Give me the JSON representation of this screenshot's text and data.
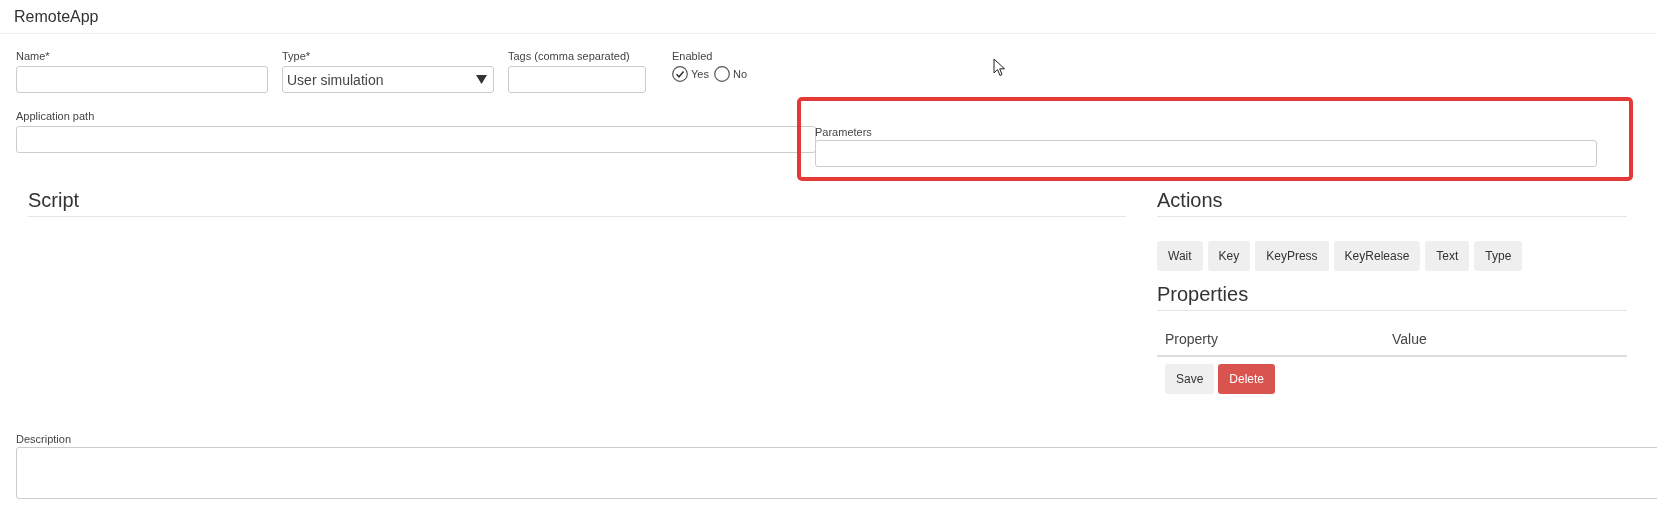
{
  "title": "RemoteApp",
  "fields": [
    {
      "label": "Name*",
      "kind": "text"
    },
    {
      "label": "Type*",
      "kind": "select",
      "value": "User simulation"
    },
    {
      "label": "Tags (comma separated)",
      "kind": "text"
    }
  ],
  "enabled": {
    "label": "Enabled",
    "options": [
      {
        "label": "Yes",
        "selected": true
      },
      {
        "label": "No",
        "selected": false
      }
    ]
  },
  "application_path": {
    "label": "Application path"
  },
  "parameters": {
    "label": "Parameters",
    "highlighted": true
  },
  "script": {
    "heading": "Script"
  },
  "actions": {
    "heading": "Actions",
    "buttons": [
      "Wait",
      "Key",
      "KeyPress",
      "KeyRelease",
      "Text",
      "Type"
    ]
  },
  "properties": {
    "heading": "Properties",
    "columns": [
      "Property",
      "Value"
    ],
    "buttons": [
      {
        "label": "Save",
        "kind": "default"
      },
      {
        "label": "Delete",
        "kind": "danger"
      }
    ]
  },
  "description": {
    "label": "Description"
  }
}
